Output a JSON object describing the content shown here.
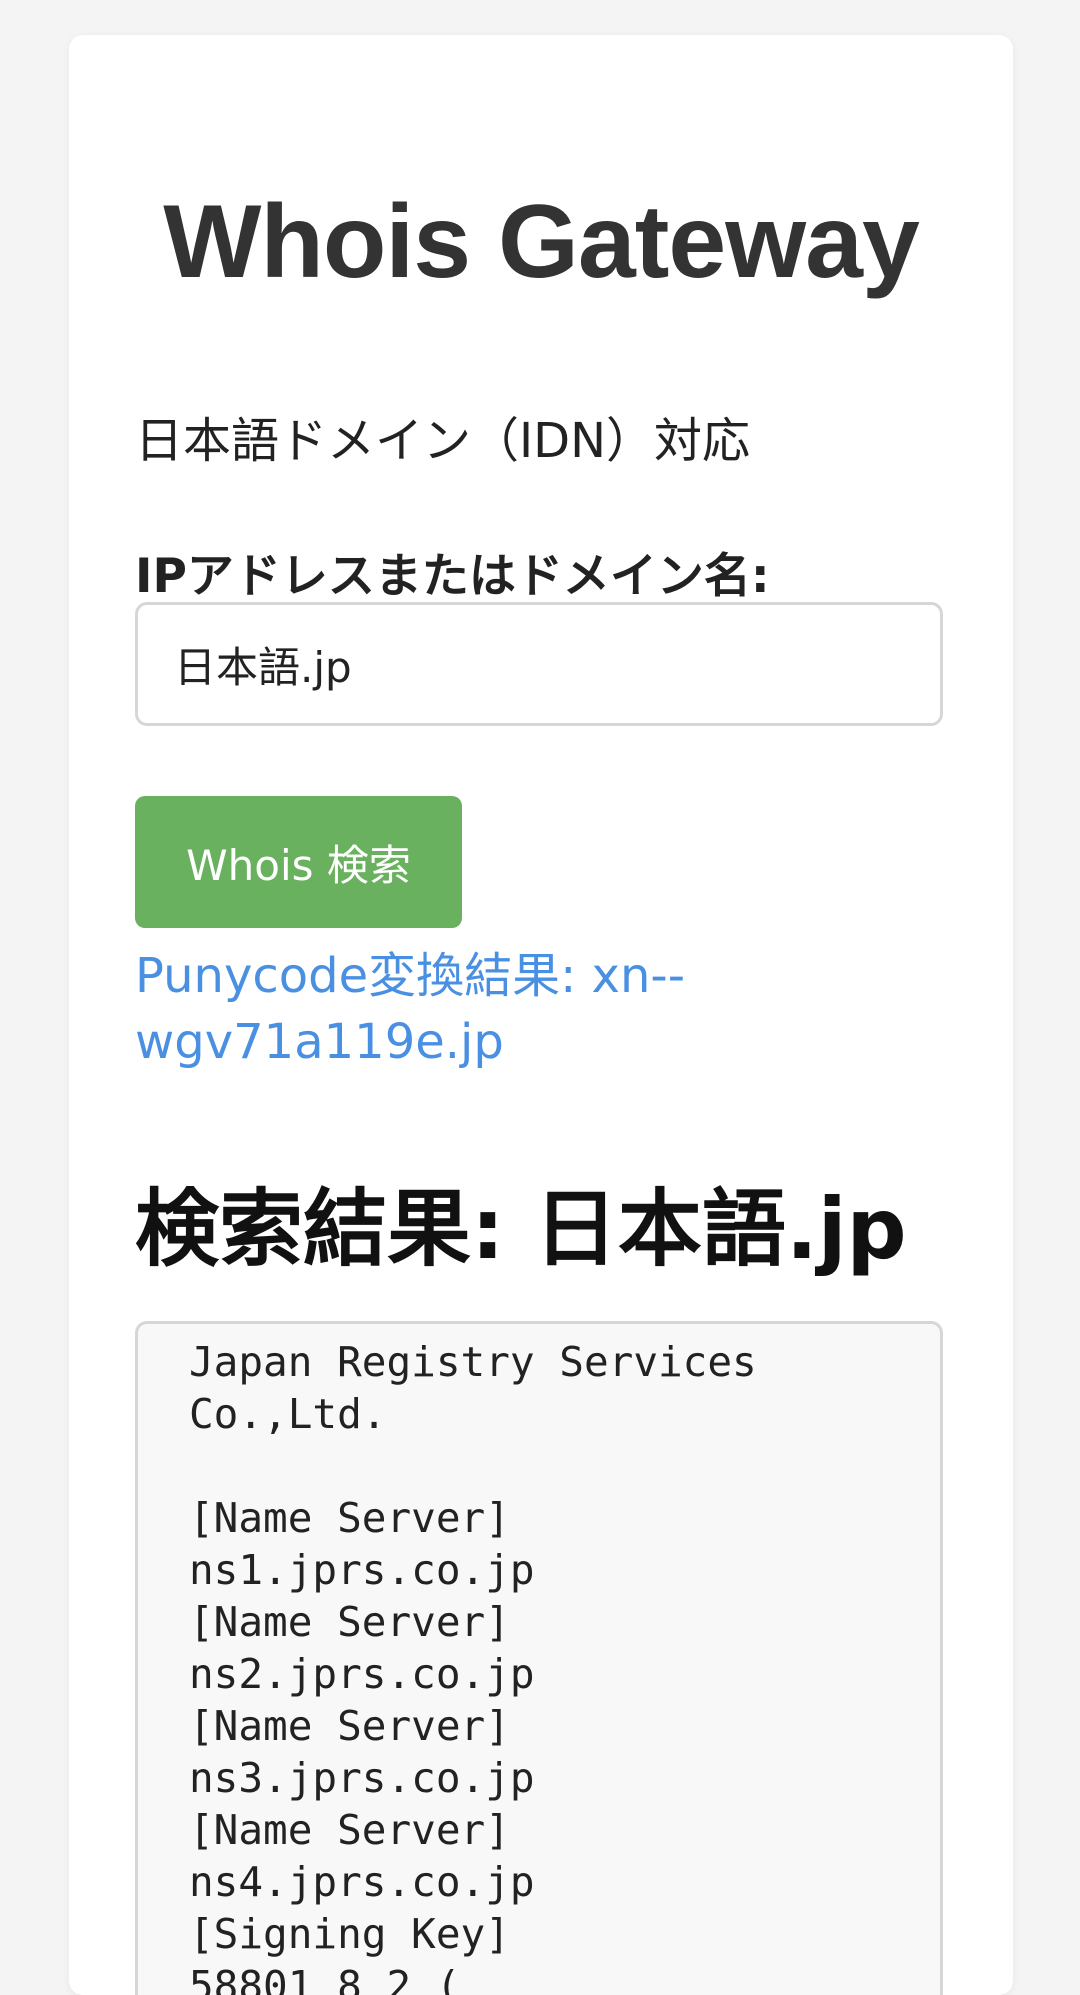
{
  "app": {
    "title": "Whois Gateway",
    "subtitle": "日本語ドメイン（IDN）対応"
  },
  "form": {
    "label": "IPアドレスまたはドメイン名:",
    "input_value": "日本語.jp",
    "button_label": "Whois 検索"
  },
  "punycode": {
    "text": "Punycode変換結果: xn--wgv71a119e.jp"
  },
  "results": {
    "heading": "検索結果: 日本語.jp",
    "lines": [
      "",
      "Japan Registry Services",
      "Co.,Ltd.",
      "",
      "[Name Server]",
      "ns1.jprs.co.jp",
      "[Name Server]",
      "ns2.jprs.co.jp",
      "[Name Server]",
      "ns3.jprs.co.jp",
      "[Name Server]",
      "ns4.jprs.co.jp",
      "[Signing Key]",
      "58801 8 2 ("
    ]
  }
}
